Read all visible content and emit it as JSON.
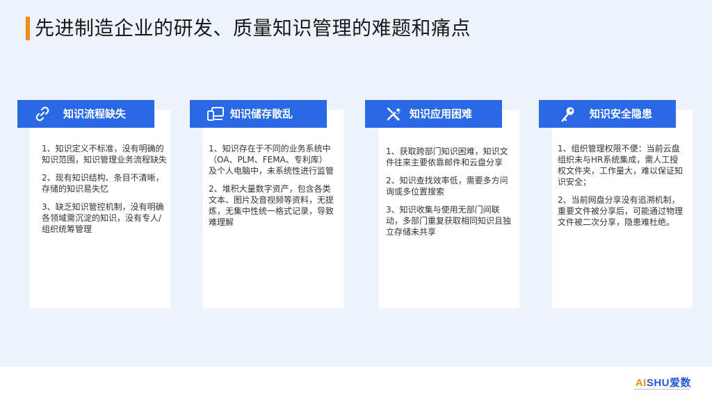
{
  "title": "先进制造企业的研发、质量知识管理的难题和痛点",
  "cards": [
    {
      "icon": "link-icon",
      "title": "知识流程缺失",
      "items": [
        "1、知识定义不标准，没有明确的知识范围，知识管理业务流程缺失",
        "2、现有知识结构、条目不清晰，存储的知识易失忆",
        "3、缺乏知识管控机制，没有明确各领域需沉淀的知识，没有专人/组织统筹管理"
      ]
    },
    {
      "icon": "devices-icon",
      "title": "知识储存散乱",
      "items": [
        "1、知识存在于不同的业务系统中（OA、PLM、FEMA、专利库）及个人电脑中，未系统性进行监管",
        "2、堆积大量数字资产，包含各类文本、图片及音视频等资料，无提炼，无集中性统一格式记录，导致难理解"
      ]
    },
    {
      "icon": "tools-icon",
      "title": "知识应用困难",
      "items": [
        "1、获取跨部门知识困难，知识文件往来主要依靠邮件和云盘分享",
        "2、知识查找效率低，需要多方问询或多位置搜索",
        "3、知识收集与使用无部门间联动，多部门重复获取相同知识且独立存储未共享"
      ]
    },
    {
      "icon": "key-icon",
      "title": "知识安全隐患",
      "items": [
        "1、组织管理权限不便：当前云盘组织未与HR系统集成，需人工授权文件夹，工作量大，难以保证知识安全；",
        "2、当前网盘分享没有追溯机制，重要文件被分享后，可能通过物理文件被二次分享，隐患难杜绝。"
      ]
    }
  ],
  "logo": {
    "ai": "AI",
    "rest": "SHU爱数"
  },
  "colors": {
    "accent": "#2a69e5",
    "title_bar": "#f08a1c"
  }
}
